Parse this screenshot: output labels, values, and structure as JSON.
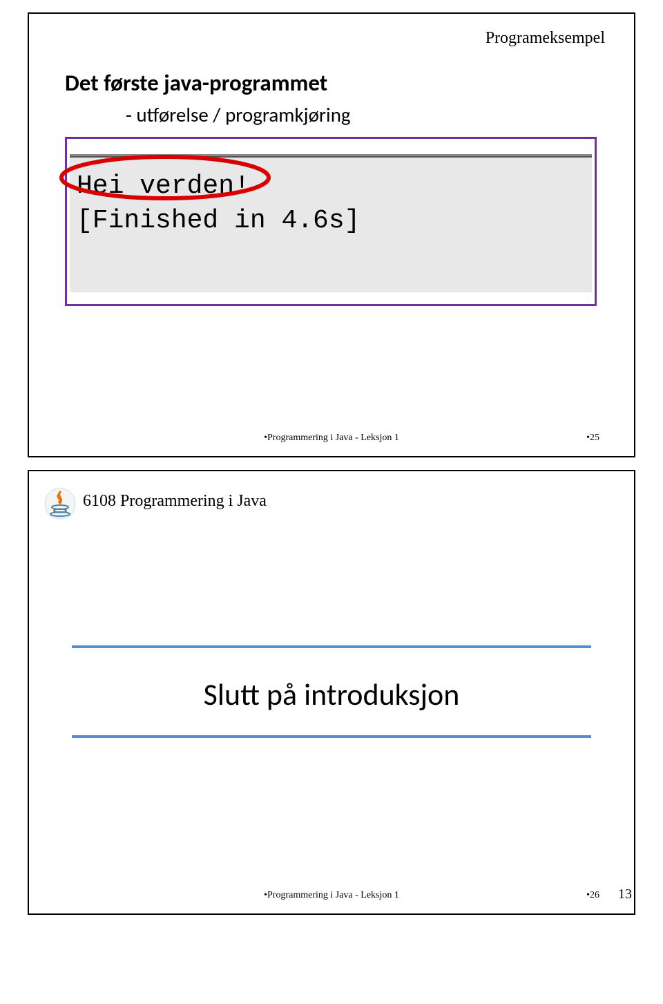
{
  "slide1": {
    "tag": "Programeksempel",
    "title": "Det første java-programmet",
    "subtitle": "- utførelse / programkjøring",
    "console": {
      "line1": "Hei verden!",
      "line2": "[Finished in 4.6s]"
    },
    "footer_center": "•Programmering i Java - Leksjon 1",
    "footer_right": "•25"
  },
  "slide2": {
    "course": "6108 Programmering i Java",
    "title": "Slutt på introduksjon",
    "footer_center": "•Programmering i Java - Leksjon 1",
    "footer_right": "•26"
  },
  "page_number": "13"
}
